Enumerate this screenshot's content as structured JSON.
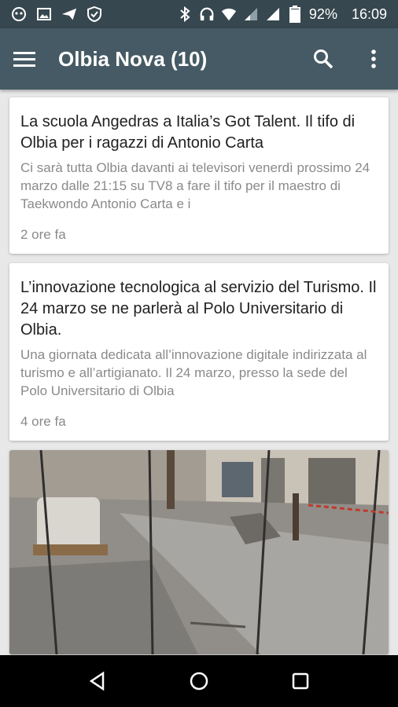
{
  "status_bar": {
    "battery": "92%",
    "time": "16:09"
  },
  "app_bar": {
    "title": "Olbia Nova (10)"
  },
  "articles": [
    {
      "headline": "La scuola Angedras a Italia’s Got Talent. Il tifo di Olbia per i ragazzi di Antonio Carta",
      "snippet": "Ci sarà tutta Olbia davanti ai televisori venerdì prossimo 24 marzo dalle 21:15 su TV8 a fare il tifo per il maestro di Taekwondo Antonio Carta e i",
      "time": "2 ore fa"
    },
    {
      "headline": "L’innovazione tecnologica al servizio del Turismo. Il 24 marzo se ne parlerà al Polo Universitario di Olbia.",
      "snippet": "Una giornata dedicata all’innovazione digitale indirizzata al turismo e all’artigianato. Il 24 marzo, presso la sede del Polo Universitario di Olbia",
      "time": "4 ore fa"
    }
  ],
  "colors": {
    "status_bar": "#37474f",
    "app_bar": "#455a64"
  }
}
